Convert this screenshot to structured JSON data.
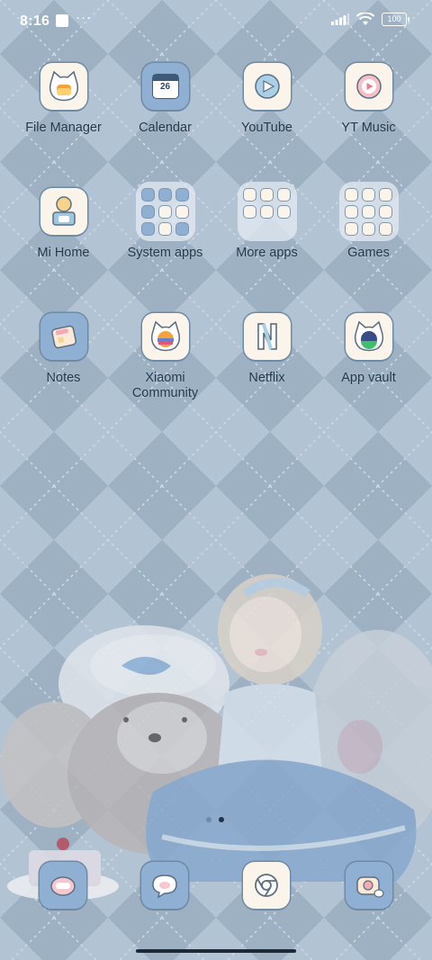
{
  "status_bar": {
    "time": "8:16",
    "battery": "100",
    "icons": [
      "notification-square-icon",
      "more-dots-icon",
      "signal-icon",
      "wifi-icon",
      "battery-icon"
    ]
  },
  "apps": [
    {
      "label": "File Manager",
      "icon": "cat-face-icon"
    },
    {
      "label": "Calendar",
      "icon": "calendar-icon",
      "date": "26"
    },
    {
      "label": "YouTube",
      "icon": "play-icon"
    },
    {
      "label": "YT Music",
      "icon": "music-play-icon"
    },
    {
      "label": "Mi Home",
      "icon": "mi-home-icon"
    },
    {
      "label": "System apps",
      "icon": "folder-icon"
    },
    {
      "label": "More apps",
      "icon": "folder-icon"
    },
    {
      "label": "Games",
      "icon": "folder-icon"
    },
    {
      "label": "Notes",
      "icon": "notes-icon"
    },
    {
      "label": "Xiaomi Community",
      "label_lines": [
        "Xiaomi",
        "Community"
      ],
      "icon": "cat-planet-icon"
    },
    {
      "label": "Netflix",
      "icon": "netflix-n-icon"
    },
    {
      "label": "App vault",
      "icon": "cat-planet-icon"
    }
  ],
  "dock": [
    {
      "name": "phone",
      "icon": "phone-icon"
    },
    {
      "name": "messages",
      "icon": "message-bubble-icon"
    },
    {
      "name": "browser",
      "icon": "browser-icon"
    },
    {
      "name": "camera",
      "icon": "camera-icon"
    }
  ],
  "page_indicator": {
    "pages": 2,
    "current": 2
  },
  "colors": {
    "wallpaper": "#a9bccd",
    "label": "#23384a",
    "icon_bg": "#fbf4ea",
    "icon_blue": "#8fb0d3"
  }
}
